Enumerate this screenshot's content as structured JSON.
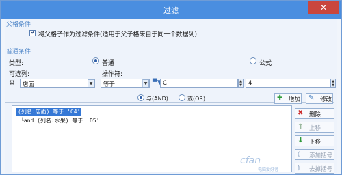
{
  "window": {
    "title": "过滤",
    "close_glyph": "✕"
  },
  "parent_condition": {
    "legend": "父格条件",
    "checkbox_label": "将父格子作为过滤条件(适用于父子格来自于同一个数据列)",
    "checked": true
  },
  "normal_condition": {
    "legend": "普通条件",
    "type_label": "类型:",
    "radio_normal": "普通",
    "radio_formula": "公式",
    "selected_type": "普通",
    "column_label": "可选列:",
    "operator_label": "操作符:",
    "column_value": "店面",
    "operator_value": "等于",
    "field_value": "C",
    "right_value": "4"
  },
  "logic": {
    "and_label": "与(AND)",
    "or_label": "或(OR)",
    "selected": "与(AND)"
  },
  "buttons": {
    "add": "增加",
    "modify": "修改",
    "delete": "删除",
    "move_up": "上移",
    "move_down": "下移",
    "add_bracket": "添加括号",
    "remove_bracket": "去掉括号"
  },
  "conditions": [
    "(列名:店面) 等于 'C4'",
    "and (列名:水果) 等于 'D5'"
  ],
  "colors": {
    "title_bar": "#4a8ee0",
    "selection": "#3578d6",
    "add_icon": "#2e9a3a",
    "delete_icon": "#cc2a2a"
  },
  "watermark": {
    "text": "cfan",
    "sub": "电脑爱好者"
  }
}
